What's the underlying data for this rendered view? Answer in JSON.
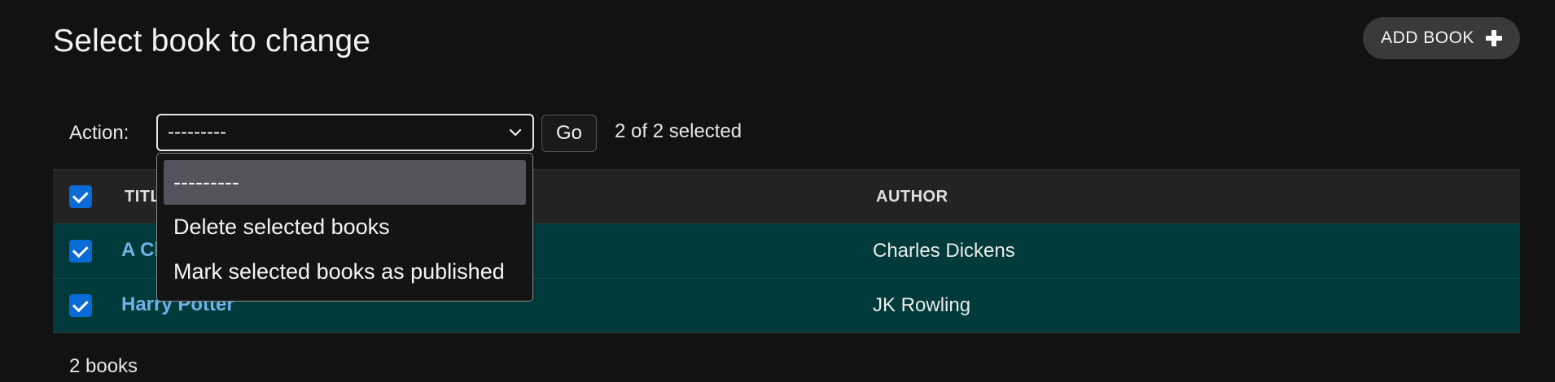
{
  "header": {
    "title": "Select book to change",
    "add_button_label": "ADD BOOK"
  },
  "actions": {
    "label": "Action:",
    "selected_value": "---------",
    "go_label": "Go",
    "selection_text": "2 of 2 selected",
    "options": [
      {
        "label": "---------",
        "selected": true
      },
      {
        "label": "Delete selected books",
        "selected": false
      },
      {
        "label": "Mark selected books as published",
        "selected": false
      }
    ]
  },
  "table": {
    "columns": [
      "TITLE",
      "AUTHOR"
    ],
    "select_all_checked": true,
    "rows": [
      {
        "title": "A Christmas Carol",
        "author": "Charles Dickens",
        "checked": true
      },
      {
        "title": "Harry Potter",
        "author": "JK Rowling",
        "checked": true
      }
    ]
  },
  "footer": {
    "result_count": "2 books"
  },
  "colors": {
    "background": "#121212",
    "selected_row": "#003a3a",
    "link": "#6eb3e6",
    "checkbox": "#0b6bd6",
    "dropdown_highlight": "#54525c"
  },
  "icons": {
    "add": "plus-icon",
    "select": "chevron-down-icon",
    "checkbox": "check-icon"
  }
}
